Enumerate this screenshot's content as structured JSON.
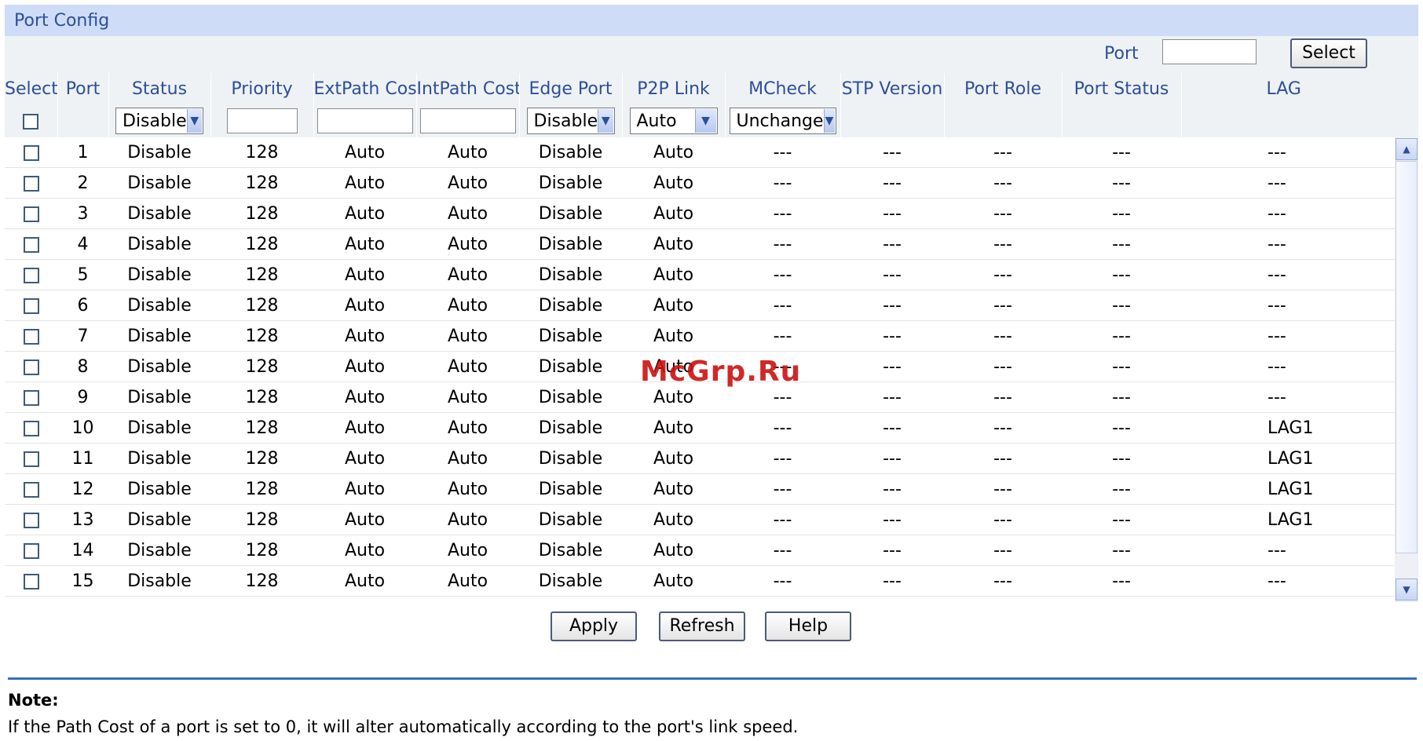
{
  "panel": {
    "title": "Port Config"
  },
  "search": {
    "port_label": "Port",
    "port_value": "",
    "select_label": "Select"
  },
  "columns": [
    "Select",
    "Port",
    "Status",
    "Priority",
    "ExtPath Cost",
    "IntPath Cost",
    "Edge Port",
    "P2P Link",
    "MCheck",
    "STP Version",
    "Port Role",
    "Port Status",
    "LAG"
  ],
  "filter": {
    "status": "Disable",
    "priority": "",
    "ext_path_cost": "",
    "int_path_cost": "",
    "edge_port": "Disable",
    "p2p_link": "Auto",
    "mcheck": "Unchange"
  },
  "rows": [
    {
      "port": "1",
      "status": "Disable",
      "priority": "128",
      "ext": "Auto",
      "int": "Auto",
      "edge": "Disable",
      "p2p": "Auto",
      "mcheck": "---",
      "stp": "---",
      "role": "---",
      "pstatus": "---",
      "lag": "---"
    },
    {
      "port": "2",
      "status": "Disable",
      "priority": "128",
      "ext": "Auto",
      "int": "Auto",
      "edge": "Disable",
      "p2p": "Auto",
      "mcheck": "---",
      "stp": "---",
      "role": "---",
      "pstatus": "---",
      "lag": "---"
    },
    {
      "port": "3",
      "status": "Disable",
      "priority": "128",
      "ext": "Auto",
      "int": "Auto",
      "edge": "Disable",
      "p2p": "Auto",
      "mcheck": "---",
      "stp": "---",
      "role": "---",
      "pstatus": "---",
      "lag": "---"
    },
    {
      "port": "4",
      "status": "Disable",
      "priority": "128",
      "ext": "Auto",
      "int": "Auto",
      "edge": "Disable",
      "p2p": "Auto",
      "mcheck": "---",
      "stp": "---",
      "role": "---",
      "pstatus": "---",
      "lag": "---"
    },
    {
      "port": "5",
      "status": "Disable",
      "priority": "128",
      "ext": "Auto",
      "int": "Auto",
      "edge": "Disable",
      "p2p": "Auto",
      "mcheck": "---",
      "stp": "---",
      "role": "---",
      "pstatus": "---",
      "lag": "---"
    },
    {
      "port": "6",
      "status": "Disable",
      "priority": "128",
      "ext": "Auto",
      "int": "Auto",
      "edge": "Disable",
      "p2p": "Auto",
      "mcheck": "---",
      "stp": "---",
      "role": "---",
      "pstatus": "---",
      "lag": "---"
    },
    {
      "port": "7",
      "status": "Disable",
      "priority": "128",
      "ext": "Auto",
      "int": "Auto",
      "edge": "Disable",
      "p2p": "Auto",
      "mcheck": "---",
      "stp": "---",
      "role": "---",
      "pstatus": "---",
      "lag": "---"
    },
    {
      "port": "8",
      "status": "Disable",
      "priority": "128",
      "ext": "Auto",
      "int": "Auto",
      "edge": "Disable",
      "p2p": "Auto",
      "mcheck": "---",
      "stp": "---",
      "role": "---",
      "pstatus": "---",
      "lag": "---"
    },
    {
      "port": "9",
      "status": "Disable",
      "priority": "128",
      "ext": "Auto",
      "int": "Auto",
      "edge": "Disable",
      "p2p": "Auto",
      "mcheck": "---",
      "stp": "---",
      "role": "---",
      "pstatus": "---",
      "lag": "---"
    },
    {
      "port": "10",
      "status": "Disable",
      "priority": "128",
      "ext": "Auto",
      "int": "Auto",
      "edge": "Disable",
      "p2p": "Auto",
      "mcheck": "---",
      "stp": "---",
      "role": "---",
      "pstatus": "---",
      "lag": "LAG1"
    },
    {
      "port": "11",
      "status": "Disable",
      "priority": "128",
      "ext": "Auto",
      "int": "Auto",
      "edge": "Disable",
      "p2p": "Auto",
      "mcheck": "---",
      "stp": "---",
      "role": "---",
      "pstatus": "---",
      "lag": "LAG1"
    },
    {
      "port": "12",
      "status": "Disable",
      "priority": "128",
      "ext": "Auto",
      "int": "Auto",
      "edge": "Disable",
      "p2p": "Auto",
      "mcheck": "---",
      "stp": "---",
      "role": "---",
      "pstatus": "---",
      "lag": "LAG1"
    },
    {
      "port": "13",
      "status": "Disable",
      "priority": "128",
      "ext": "Auto",
      "int": "Auto",
      "edge": "Disable",
      "p2p": "Auto",
      "mcheck": "---",
      "stp": "---",
      "role": "---",
      "pstatus": "---",
      "lag": "LAG1"
    },
    {
      "port": "14",
      "status": "Disable",
      "priority": "128",
      "ext": "Auto",
      "int": "Auto",
      "edge": "Disable",
      "p2p": "Auto",
      "mcheck": "---",
      "stp": "---",
      "role": "---",
      "pstatus": "---",
      "lag": "---"
    },
    {
      "port": "15",
      "status": "Disable",
      "priority": "128",
      "ext": "Auto",
      "int": "Auto",
      "edge": "Disable",
      "p2p": "Auto",
      "mcheck": "---",
      "stp": "---",
      "role": "---",
      "pstatus": "---",
      "lag": "---"
    }
  ],
  "buttons": {
    "apply": "Apply",
    "refresh": "Refresh",
    "help": "Help"
  },
  "note": {
    "title": "Note:",
    "text": "If the Path Cost of a port is set to 0, it will alter automatically according to the port's link speed."
  },
  "watermark": "McGrp.Ru",
  "icons": {
    "dropdown": "chevron-down-icon",
    "scroll_up": "arrow-up-icon",
    "scroll_down": "arrow-down-icon"
  },
  "colors": {
    "title_bg": "#cfdcf7",
    "header_text": "#2d4f9a",
    "header_bg": "#eef2f4",
    "rule": "#3b6fb8"
  }
}
